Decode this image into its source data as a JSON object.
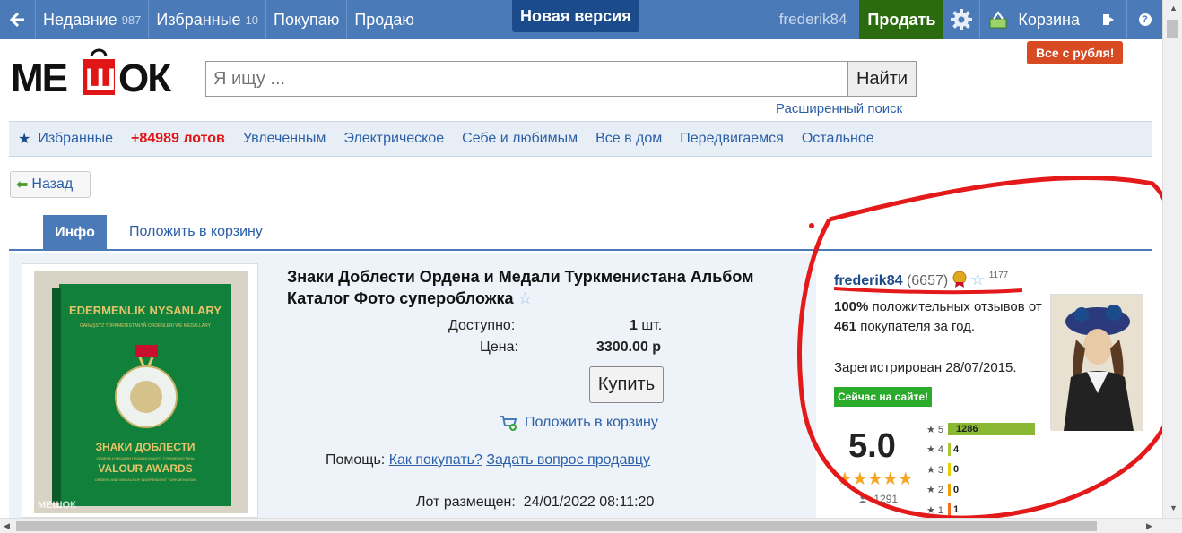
{
  "topbar": {
    "recent_label": "Недавние",
    "recent_count": "987",
    "favorites_label": "Избранные",
    "favorites_count": "10",
    "buying_label": "Покупаю",
    "selling_label": "Продаю",
    "new_version_label": "Новая версия",
    "username": "frederik84",
    "sell_button": "Продать",
    "cart_label": "Корзина",
    "help_icon": "?"
  },
  "promo": {
    "label": "Все с рубля!"
  },
  "logo": {
    "text": "МЕШОК"
  },
  "search": {
    "placeholder": "Я ищу ...",
    "button": "Найти",
    "advanced": "Расширенный поиск"
  },
  "categories": {
    "favorites": "Избранные",
    "lots": "+84989 лотов",
    "items": [
      "Увлеченным",
      "Электрическое",
      "Себе и любимым",
      "Все в дом",
      "Передвигаемся",
      "Остальное"
    ]
  },
  "nav": {
    "back": "Назад"
  },
  "tabs": {
    "info": "Инфо",
    "add_to_cart": "Положить в корзину"
  },
  "lot": {
    "image_title_top": "EDERMENLIK NYSANLARY",
    "image_sub_top": "GARAŞSYZ TÜRKMENISTANYŇ ORDENLERI WE MEDALLARY",
    "image_title_ru": "ЗНАКИ ДОБЛЕСТИ",
    "image_sub_ru": "ОРДЕНА И МЕДАЛИ НЕЗАВИСИМОГО ТУРКМЕНИСТАНА",
    "image_title_en": "VALOUR AWARDS",
    "image_sub_en": "ORDERS AND MEDALS OF INDEPENDENT TURKMENISTAN",
    "watermark": "МЕШОК",
    "title": "Знаки Доблести Ордена и Медали Туркменистана Альбом Каталог Фото суперобложка",
    "available_label": "Доступно:",
    "available_value": "1",
    "available_unit": "шт.",
    "price_label": "Цена:",
    "price_value": "3300.00 р",
    "buy_button": "Купить",
    "add_to_cart": "Положить в корзину",
    "help_label": "Помощь:",
    "help_how": "Как покупать?",
    "help_ask": "Задать вопрос продавцу",
    "posted_label": "Лот размещен:",
    "posted_value": "24/01/2022 08:11:20"
  },
  "seller": {
    "name": "frederik84",
    "feedback": "(6657)",
    "fav_count": "1177",
    "percent": "100%",
    "desc_mid": "положительных отзывов от",
    "buyers": "461",
    "desc_end": "покупателя за год.",
    "registered": "Зарегистрирован 28/07/2015.",
    "online": "Сейчас на сайте!",
    "rating": "5.0",
    "votes": "1291",
    "rating_bars": [
      {
        "stars": "5",
        "count": 1286,
        "label": "1286",
        "color": "#8ab832"
      },
      {
        "stars": "4",
        "count": 4,
        "label": "4",
        "color": "#a8c832"
      },
      {
        "stars": "3",
        "count": 0,
        "label": "0",
        "color": "#e8d000"
      },
      {
        "stars": "2",
        "count": 0,
        "label": "0",
        "color": "#f0a000"
      },
      {
        "stars": "1",
        "count": 1,
        "label": "1",
        "color": "#f07020"
      }
    ]
  }
}
